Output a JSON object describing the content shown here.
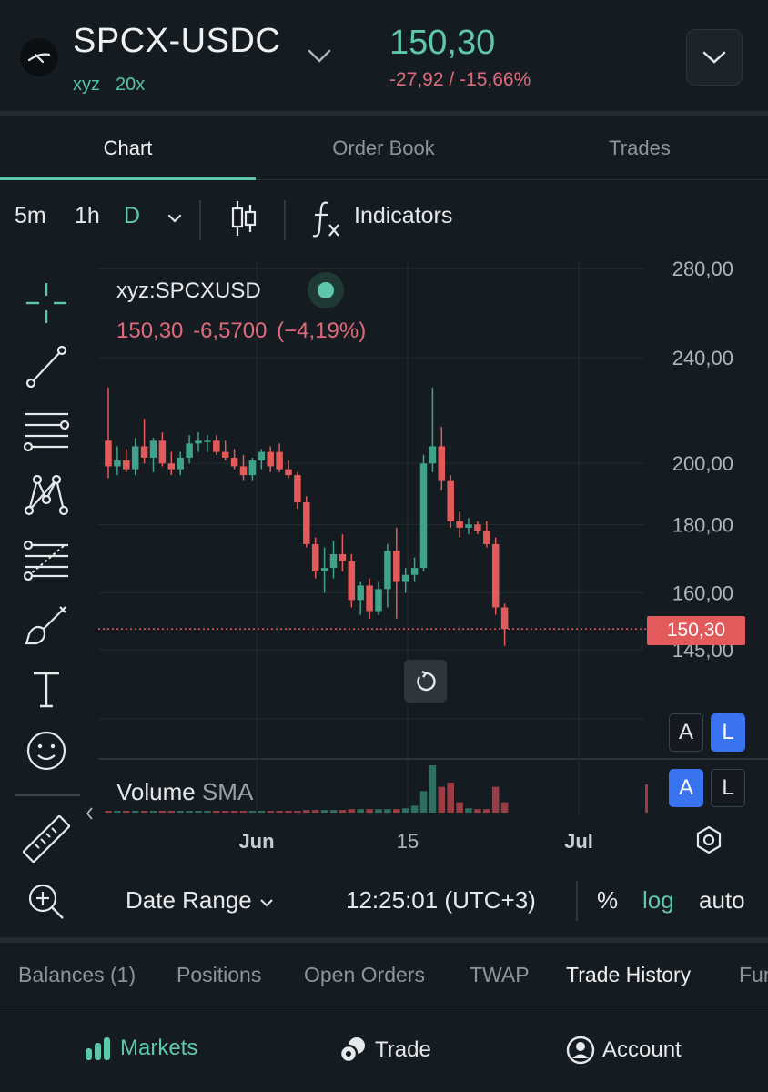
{
  "header": {
    "symbol": "SPCX-USDC",
    "dex": "xyz",
    "leverage": "20x",
    "price": "150,30",
    "change": "-27,92 / -15,66%"
  },
  "tabs": [
    "Chart",
    "Order Book",
    "Trades"
  ],
  "toolbar": {
    "intervals": [
      "5m",
      "1h",
      "D"
    ],
    "indicators_label": "Indicators"
  },
  "legend": {
    "symbol": "xyz:SPCXUSD",
    "close": "150,30",
    "change_abs": "-6,5700",
    "change_pct": "(−4,19%)"
  },
  "volume_label": "Volume",
  "volume_sma": "SMA",
  "price_tag": "150,30",
  "scale_buttons": {
    "a": "A",
    "l": "L"
  },
  "bottom": {
    "date_range": "Date Range",
    "time": "12:25:01 (UTC+3)",
    "percent": "%",
    "log": "log",
    "auto": "auto"
  },
  "account_tabs": [
    "Balances (1)",
    "Positions",
    "Open Orders",
    "TWAP",
    "Trade History",
    "Fun"
  ],
  "nav": {
    "markets": "Markets",
    "trade": "Trade",
    "account": "Account"
  },
  "colors": {
    "accent": "#5fc7ad",
    "down": "#e0697b",
    "candle_up": "#3fa28b",
    "candle_down": "#e35a5a"
  },
  "chart_data": {
    "type": "candlestick",
    "y_ticks": [
      "280,00",
      "240,00",
      "200,00",
      "180,00",
      "160,00",
      "145,00"
    ],
    "x_ticks": [
      "Jun",
      "15",
      "Jul"
    ],
    "scale": "log",
    "last_price": 150.3,
    "candles": [
      {
        "o": 208,
        "h": 228,
        "l": 195,
        "c": 199
      },
      {
        "o": 199,
        "h": 206,
        "l": 196,
        "c": 201
      },
      {
        "o": 201,
        "h": 205,
        "l": 197,
        "c": 198
      },
      {
        "o": 198,
        "h": 209,
        "l": 196,
        "c": 206
      },
      {
        "o": 206,
        "h": 216,
        "l": 200,
        "c": 202
      },
      {
        "o": 202,
        "h": 209,
        "l": 197,
        "c": 208
      },
      {
        "o": 208,
        "h": 211,
        "l": 199,
        "c": 200
      },
      {
        "o": 200,
        "h": 204,
        "l": 196,
        "c": 198
      },
      {
        "o": 198,
        "h": 204,
        "l": 196,
        "c": 202
      },
      {
        "o": 202,
        "h": 210,
        "l": 200,
        "c": 207
      },
      {
        "o": 207,
        "h": 211,
        "l": 204,
        "c": 208
      },
      {
        "o": 208,
        "h": 210,
        "l": 204,
        "c": 208
      },
      {
        "o": 208,
        "h": 210,
        "l": 203,
        "c": 204
      },
      {
        "o": 204,
        "h": 208,
        "l": 201,
        "c": 202
      },
      {
        "o": 202,
        "h": 205,
        "l": 198,
        "c": 199
      },
      {
        "o": 199,
        "h": 203,
        "l": 194,
        "c": 196
      },
      {
        "o": 196,
        "h": 202,
        "l": 194,
        "c": 201
      },
      {
        "o": 201,
        "h": 205,
        "l": 198,
        "c": 204
      },
      {
        "o": 204,
        "h": 206,
        "l": 197,
        "c": 199
      },
      {
        "o": 204,
        "h": 207,
        "l": 197,
        "c": 198
      },
      {
        "o": 198,
        "h": 201,
        "l": 195,
        "c": 196
      },
      {
        "o": 196,
        "h": 197,
        "l": 185,
        "c": 187
      },
      {
        "o": 187,
        "h": 189,
        "l": 173,
        "c": 174
      },
      {
        "o": 174,
        "h": 176,
        "l": 164,
        "c": 166
      },
      {
        "o": 166,
        "h": 173,
        "l": 160,
        "c": 167
      },
      {
        "o": 167,
        "h": 175,
        "l": 164,
        "c": 171
      },
      {
        "o": 171,
        "h": 177,
        "l": 166,
        "c": 169
      },
      {
        "o": 169,
        "h": 171,
        "l": 156,
        "c": 158
      },
      {
        "o": 158,
        "h": 163,
        "l": 154,
        "c": 162
      },
      {
        "o": 162,
        "h": 164,
        "l": 153,
        "c": 155
      },
      {
        "o": 155,
        "h": 163,
        "l": 154,
        "c": 161
      },
      {
        "o": 161,
        "h": 174,
        "l": 156,
        "c": 172
      },
      {
        "o": 172,
        "h": 179,
        "l": 153,
        "c": 163
      },
      {
        "o": 163,
        "h": 167,
        "l": 160,
        "c": 165
      },
      {
        "o": 165,
        "h": 170,
        "l": 163,
        "c": 167
      },
      {
        "o": 167,
        "h": 203,
        "l": 166,
        "c": 200
      },
      {
        "o": 200,
        "h": 228,
        "l": 197,
        "c": 206
      },
      {
        "o": 206,
        "h": 213,
        "l": 191,
        "c": 194
      },
      {
        "o": 194,
        "h": 196,
        "l": 179,
        "c": 181
      },
      {
        "o": 181,
        "h": 184,
        "l": 176,
        "c": 179
      },
      {
        "o": 179,
        "h": 182,
        "l": 177,
        "c": 180
      },
      {
        "o": 180,
        "h": 181,
        "l": 177,
        "c": 178
      },
      {
        "o": 178,
        "h": 181,
        "l": 173,
        "c": 174
      },
      {
        "o": 174,
        "h": 176,
        "l": 154,
        "c": 156
      },
      {
        "o": 156,
        "h": 157,
        "l": 146,
        "c": 150.3
      }
    ],
    "volume": [
      2,
      2,
      2,
      2,
      2,
      2,
      2,
      2,
      2,
      2,
      2,
      2,
      2,
      2,
      2,
      2,
      2,
      2,
      2,
      2,
      2,
      2,
      3,
      3,
      3,
      3,
      3,
      4,
      4,
      4,
      4,
      4,
      4,
      5,
      8,
      25,
      55,
      30,
      35,
      12,
      5,
      4,
      4,
      30,
      12
    ]
  }
}
